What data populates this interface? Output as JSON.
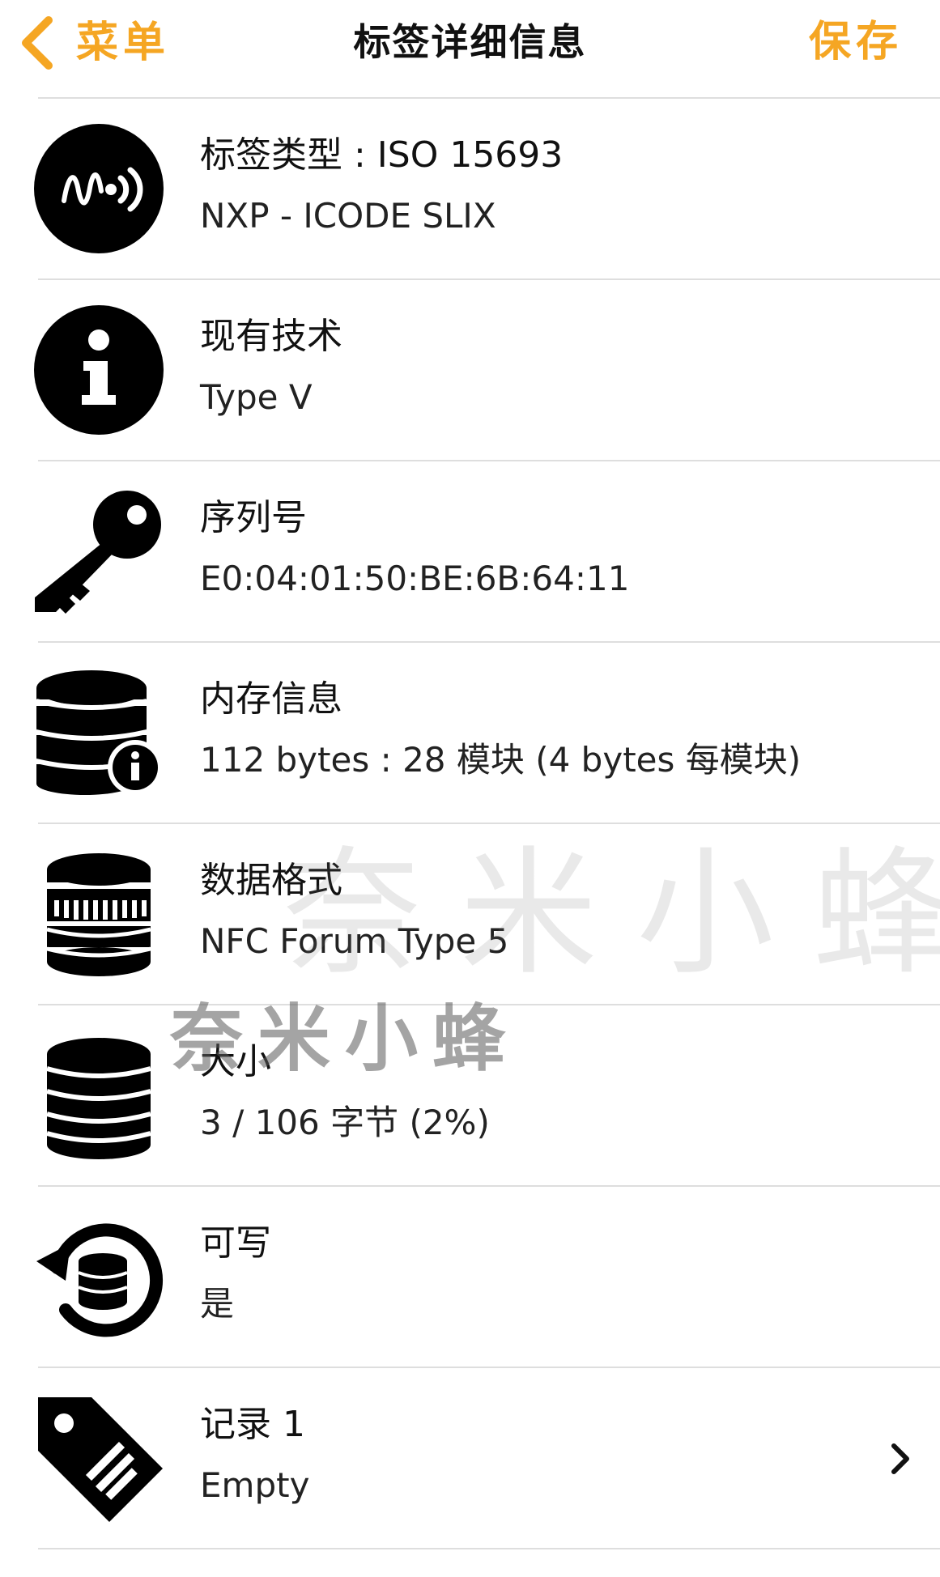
{
  "nav": {
    "back_label": "菜单",
    "title": "标签详细信息",
    "save_label": "保存"
  },
  "rows": [
    {
      "icon": "nfc-tag-icon",
      "title": "标签类型 : ISO 15693",
      "subtitle": "NXP - ICODE SLIX"
    },
    {
      "icon": "info-icon",
      "title": "现有技术",
      "subtitle": "Type V"
    },
    {
      "icon": "key-icon",
      "title": "序列号",
      "subtitle": "E0:04:01:50:BE:6B:64:11"
    },
    {
      "icon": "memory-info-icon",
      "title": "内存信息",
      "subtitle": "112 bytes : 28 模块 (4 bytes 每模块)"
    },
    {
      "icon": "data-format-icon",
      "title": "数据格式",
      "subtitle": "NFC Forum Type 5"
    },
    {
      "icon": "database-icon",
      "title": "大小",
      "subtitle": "3 / 106 字节 (2%)"
    },
    {
      "icon": "writable-icon",
      "title": "可写",
      "subtitle": "是"
    },
    {
      "icon": "record-tag-icon",
      "title": "记录 1",
      "subtitle": "Empty"
    }
  ],
  "watermark": {
    "text_large": "奈米小蜂",
    "text_small": "奈米小蜂"
  },
  "colors": {
    "accent": "#F5A623",
    "text": "#111111",
    "divider": "#DEDEDE",
    "background": "#FFFFFF"
  }
}
